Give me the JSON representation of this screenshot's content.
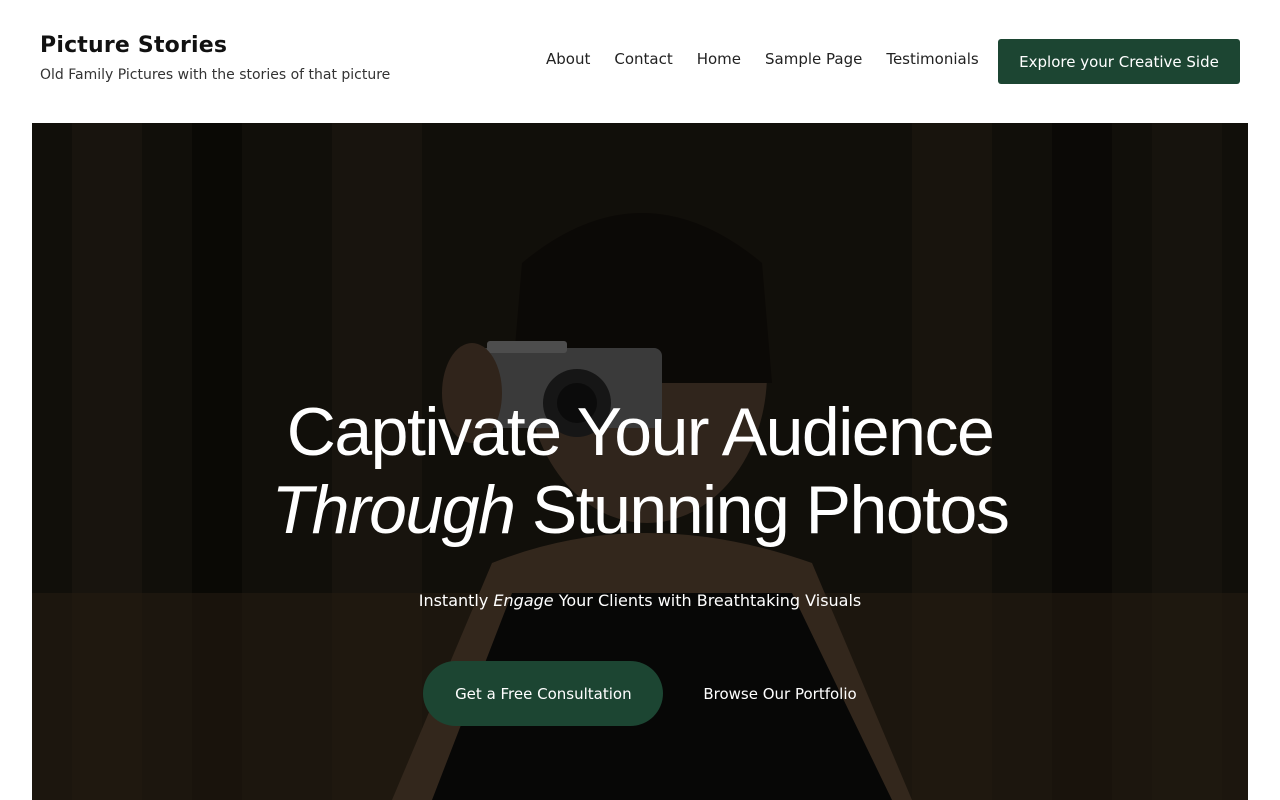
{
  "site": {
    "title": "Picture Stories",
    "tagline": "Old Family Pictures with the stories of that picture"
  },
  "nav": {
    "items": [
      {
        "label": "About"
      },
      {
        "label": "Contact"
      },
      {
        "label": "Home"
      },
      {
        "label": "Sample Page"
      },
      {
        "label": "Testimonials"
      }
    ]
  },
  "header_cta": {
    "label": "Explore your Creative Side"
  },
  "hero": {
    "title_line1": "Captivate Your Audience",
    "title_line2_em": "Through",
    "title_line2_rest": " Stunning Photos",
    "subtitle_pre": "Instantly ",
    "subtitle_em": "Engage",
    "subtitle_post": " Your Clients with Breathtaking Visuals",
    "primary_button": "Get a Free Consultation",
    "secondary_button": "Browse Our Portfolio"
  },
  "colors": {
    "accent": "#1c4532",
    "background": "#ffffff",
    "hero_text": "#ffffff"
  }
}
